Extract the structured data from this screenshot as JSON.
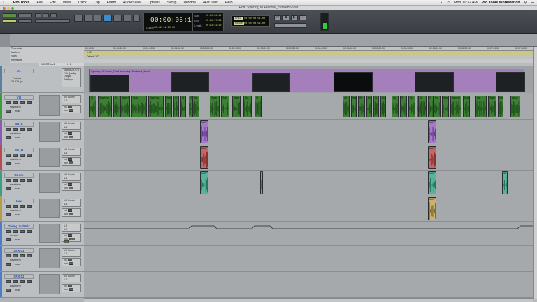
{
  "menubar": {
    "app": "Pro Tools",
    "items": [
      "File",
      "Edit",
      "View",
      "Track",
      "Clip",
      "Event",
      "AudioSuite",
      "Options",
      "Setup",
      "Window",
      "Avid Link",
      "Help"
    ],
    "clock": "Mon 10:32 AM",
    "right_app": "Pro Tools Workstation"
  },
  "window": {
    "title": "Edit: Syncing in Premire_ScreenShots"
  },
  "counter": {
    "main": "00:00:05:15",
    "cursor_label": "Cursor",
    "cursor": "00:32:14+15:00"
  },
  "selection": {
    "start_label": "Start",
    "start": "00:00:05:15",
    "end_label": "End",
    "end": "00:12:17:36",
    "length_label": "Length",
    "length": "00:12:11:10"
  },
  "grid": {
    "grid_label": "Grid",
    "grid_value": "00:00:00:01.00",
    "nudge_label": "Nudge",
    "nudge_value": "00:00:00:01.00"
  },
  "rulers": {
    "labels": [
      "Timecode",
      "Markers",
      "Video",
      "Keyframe"
    ]
  },
  "markers": {
    "marker1": "1:00",
    "marker2": "Default: VO"
  },
  "timeline": {
    "ticks": [
      "00:00:00",
      "00:00:30:00",
      "00:01:00:00",
      "00:01:30:00",
      "00:02:00:00",
      "00:02:30:00",
      "00:03:00:00",
      "00:03:30:00",
      "00:04:00:00",
      "00:04:30:00",
      "00:05:00:00",
      "00:05:30:00",
      "00:06:00:00",
      "00:06:30:00",
      "00:07:00:00",
      "00:07:30:00"
    ]
  },
  "io_header": {
    "col1": "INSERTS A-E",
    "col2": "I / O"
  },
  "video_track": {
    "name": "V1",
    "mode": "Frames",
    "rate": "23.976 fps",
    "io1": "1080p/23.976",
    "io2": "Full Quality",
    "io3": "Output Settings",
    "clip_name": "Syncing in Premire_Final Assembly Rendered_1.mxf"
  },
  "tracks": [
    {
      "name": "VO",
      "color": "#3f9a3f",
      "io1": "VO Booth",
      "io2": "1-2",
      "view": "waveform",
      "vol": "0.0",
      "pan": "0.0",
      "mode": "read",
      "wavecolor": "#2f6d2a",
      "clipcolor": "#3c7f35"
    },
    {
      "name": "SD_L",
      "color": "#8a5bb3",
      "io1": "VO Booth",
      "io2": "3-4",
      "view": "waveform",
      "vol": "0.0",
      "pan": "0.0",
      "mode": "read",
      "wavecolor": "#6b3d99",
      "clipcolor": "#a67ac8"
    },
    {
      "name": "SD_R",
      "color": "#b84b4b",
      "io1": "VO Booth",
      "io2": "3-4",
      "view": "waveform",
      "vol": "0.0",
      "pan": "0.0",
      "mode": "read",
      "wavecolor": "#8e2e2e",
      "clipcolor": "#c56767"
    },
    {
      "name": "Boom",
      "color": "#3c9e83",
      "io1": "VO Booth",
      "io2": "3-4",
      "view": "waveform",
      "vol": "0.0",
      "pan": "0.0",
      "mode": "read",
      "wavecolor": "#1f6b58",
      "clipcolor": "#58b59a"
    },
    {
      "name": "Lav",
      "color": "#b49c4e",
      "io1": "VO Booth",
      "io2": "3-4",
      "view": "waveform",
      "vol": "0.0",
      "pan": "0.0",
      "mode": "read",
      "wavecolor": "#7f6a2a",
      "clipcolor": "#c9b270"
    },
    {
      "name": "Dialog SubMix",
      "color": "#4f7cc7",
      "io1": "1-2",
      "io2": "1-2",
      "view": "volume",
      "vol": "0.0",
      "pan": "<100 100>",
      "mode": "read",
      "wavecolor": "#333",
      "clipcolor": "#a6a9ac"
    },
    {
      "name": "SFX 01",
      "color": "#4f7cc7",
      "io1": "VO Booth",
      "io2": "1-2",
      "view": "waveform",
      "vol": "0.0",
      "pan": "0.0",
      "mode": "read",
      "wavecolor": "#333",
      "clipcolor": "#a6a9ac"
    },
    {
      "name": "SFX 02",
      "color": "#4f7cc7",
      "io1": "VO Booth",
      "io2": "1-2",
      "view": "waveform",
      "vol": "0.0",
      "pan": "0.0",
      "mode": "read",
      "wavecolor": "#333",
      "clipcolor": "#a6a9ac"
    }
  ],
  "vo_clips": [
    {
      "l": "Sl"
    },
    {
      "l": "SlateSyn"
    },
    {
      "l": "Sl"
    },
    {
      "l": "SlateSyn"
    },
    {
      "l": "Slate"
    },
    {
      "l": "SlateSyn"
    },
    {
      "l": "SlateSyn"
    },
    {
      "l": "Sl"
    },
    {
      "l": "Sl"
    },
    {
      "l": "Sl"
    },
    {
      "l": "Sla"
    },
    {
      "l": "Slate"
    },
    {
      "l": "Slat"
    },
    {
      "l": "Slate"
    },
    {
      "l": "Sla"
    },
    {
      "l": "Sl"
    },
    {
      "l": "Wi"
    },
    {
      "l": "Wa"
    },
    {
      "l": "Wi"
    },
    {
      "l": "Wa"
    },
    {
      "l": "Sl"
    },
    {
      "l": "Sla"
    },
    {
      "l": "Wa"
    },
    {
      "l": "Sl"
    },
    {
      "l": "Sla"
    },
    {
      "l": "Wa"
    },
    {
      "l": "Sl"
    },
    {
      "l": "Sl"
    },
    {
      "l": "Da"
    },
    {
      "l": "Wav"
    },
    {
      "l": "Wavefo"
    },
    {
      "l": "SlateS"
    },
    {
      "l": "Wa"
    },
    {
      "l": "Slate"
    },
    {
      "l": "Wave"
    },
    {
      "l": "Wave"
    }
  ],
  "multi_clip_label": "MIXPR",
  "boom_small_label": "SL",
  "sfx_clip_label": "WAVE"
}
